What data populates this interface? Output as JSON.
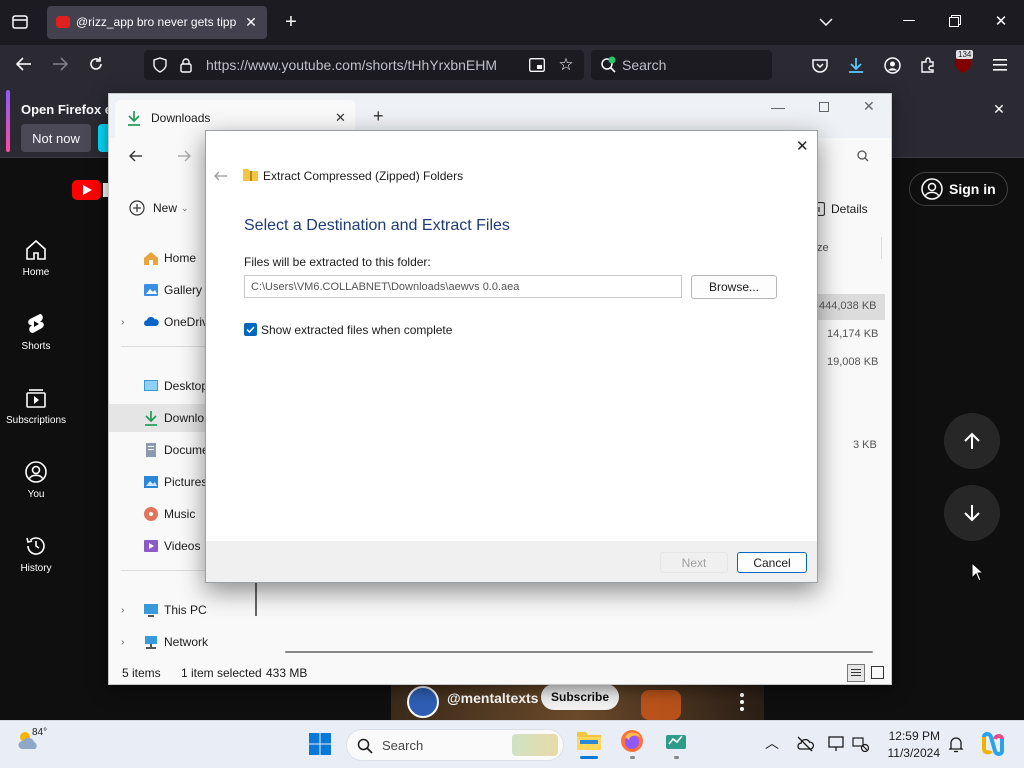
{
  "firefox": {
    "tab_title": "@rizz_app bro never gets tippe",
    "url": "https://www.youtube.com/shorts/tHhYrxbnEHM",
    "search_placeholder": "Search",
    "extension_badge": "134",
    "notif_title": "Open Firefox ev",
    "notif_not_now": "Not now"
  },
  "youtube": {
    "sign_in": "Sign in",
    "nav": [
      {
        "label": "Home"
      },
      {
        "label": "Shorts"
      },
      {
        "label": "Subscriptions"
      },
      {
        "label": "You"
      },
      {
        "label": "History"
      }
    ],
    "channel": "@mentaltexts",
    "subscribe": "Subscribe"
  },
  "explorer": {
    "title": "Downloads",
    "new_label": "New",
    "details_label": "Details",
    "col_size_partial": "ze",
    "sizes": [
      "444,038 KB",
      "14,174 KB",
      "19,008 KB",
      "3 KB"
    ],
    "nav": {
      "home": "Home",
      "gallery": "Gallery",
      "onedrive": "OneDriv",
      "desktop": "Desktop",
      "downloads": "Downlo",
      "documents": "Docume",
      "pictures": "Pictures",
      "music": "Music",
      "videos": "Videos",
      "thispc": "This PC",
      "network": "Network"
    },
    "status_items": "5 items",
    "status_selected": "1 item selected",
    "status_size": "433 MB"
  },
  "dialog": {
    "title": "Extract Compressed (Zipped) Folders",
    "heading": "Select a Destination and Extract Files",
    "folder_label": "Files will be extracted to this folder:",
    "path": "C:\\Users\\VM6.COLLABNET\\Downloads\\aewvs 0.0.aea",
    "browse": "Browse...",
    "checkbox_label": "Show extracted files when complete",
    "checkbox_checked": true,
    "next": "Next",
    "cancel": "Cancel"
  },
  "taskbar": {
    "weather_temp": "84°",
    "search_label": "Search",
    "time": "12:59 PM",
    "date": "11/3/2024"
  }
}
